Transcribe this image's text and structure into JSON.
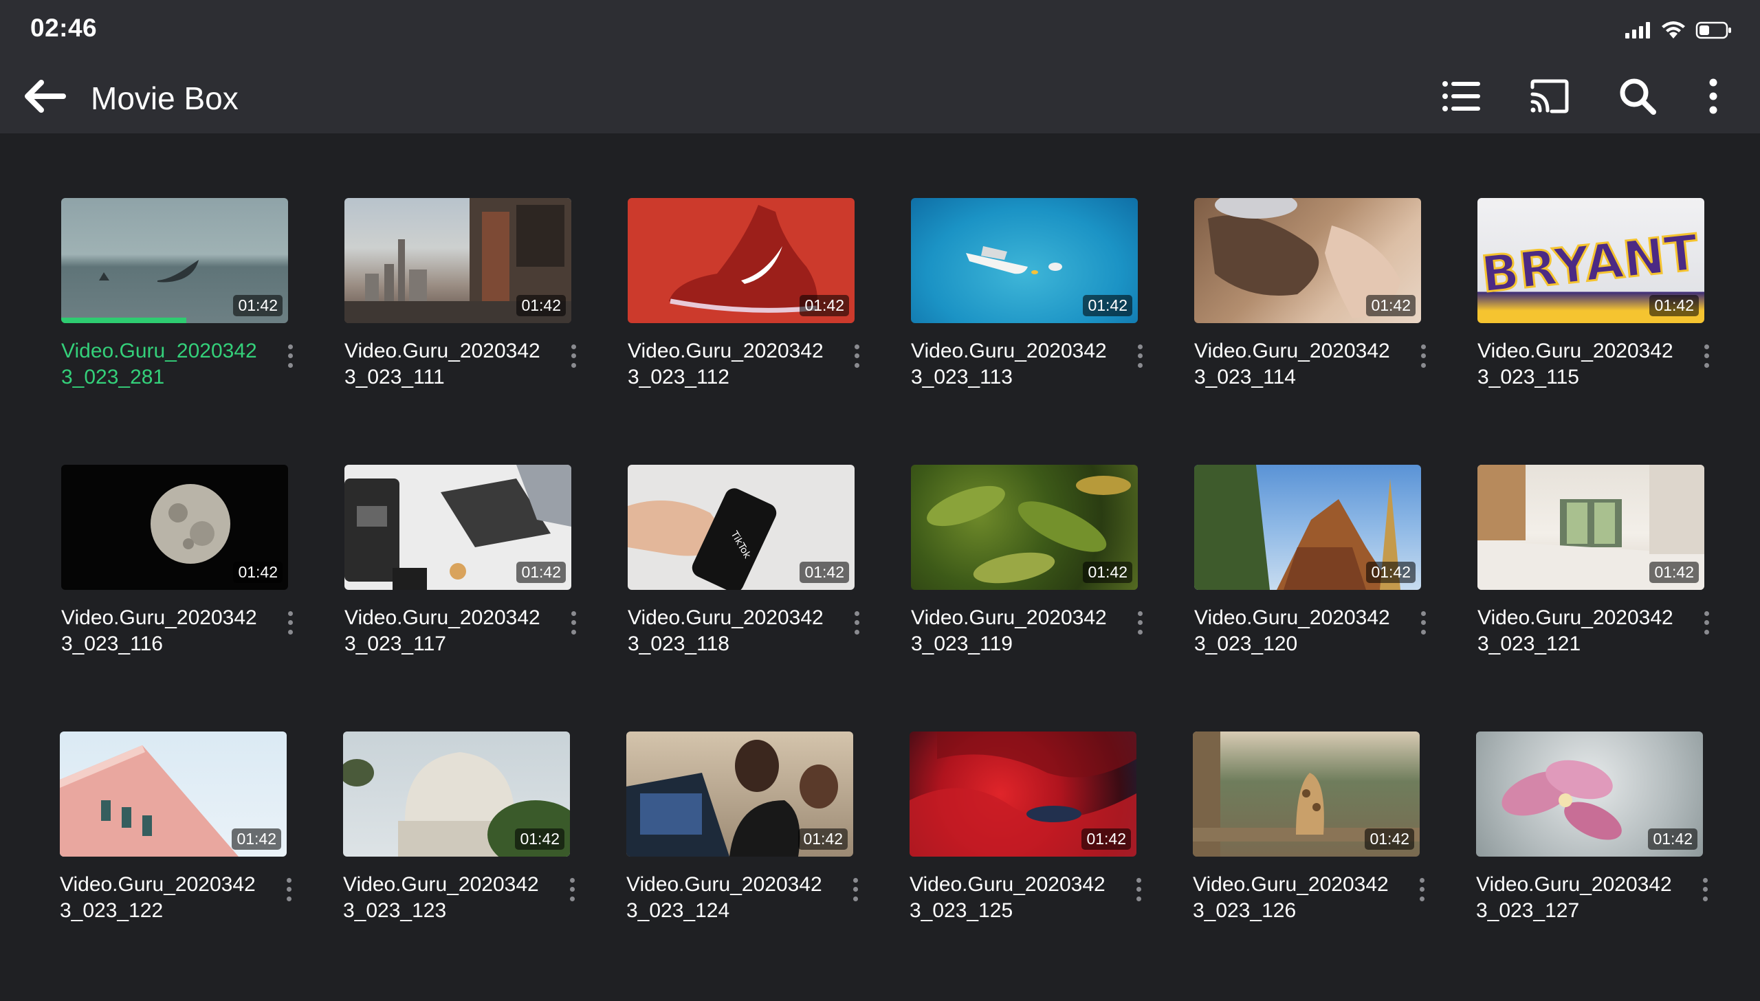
{
  "status": {
    "time": "02:46"
  },
  "appbar": {
    "title": "Movie Box",
    "icons": [
      "back-arrow-icon",
      "list-view-icon",
      "cast-icon",
      "search-icon",
      "more-vert-icon"
    ]
  },
  "accent_color": "#34d07a",
  "videos": [
    {
      "title": "Video.Guru_20203423_023_281",
      "duration": "01:42",
      "active": true,
      "progress": 0.55
    },
    {
      "title": "Video.Guru_20203423_023_111",
      "duration": "01:42"
    },
    {
      "title": "Video.Guru_20203423_023_112",
      "duration": "01:42"
    },
    {
      "title": "Video.Guru_20203423_023_113",
      "duration": "01:42"
    },
    {
      "title": "Video.Guru_20203423_023_114",
      "duration": "01:42"
    },
    {
      "title": "Video.Guru_20203423_023_115",
      "duration": "01:42"
    },
    {
      "title": "Video.Guru_20203423_023_116",
      "duration": "01:42"
    },
    {
      "title": "Video.Guru_20203423_023_117",
      "duration": "01:42"
    },
    {
      "title": "Video.Guru_20203423_023_118",
      "duration": "01:42"
    },
    {
      "title": "Video.Guru_20203423_023_119",
      "duration": "01:42"
    },
    {
      "title": "Video.Guru_20203423_023_120",
      "duration": "01:42"
    },
    {
      "title": "Video.Guru_20203423_023_121",
      "duration": "01:42"
    },
    {
      "title": "Video.Guru_20203423_023_122",
      "duration": "01:42"
    },
    {
      "title": "Video.Guru_20203423_023_123",
      "duration": "01:42"
    },
    {
      "title": "Video.Guru_20203423_023_124",
      "duration": "01:42"
    },
    {
      "title": "Video.Guru_20203423_023_125",
      "duration": "01:42"
    },
    {
      "title": "Video.Guru_20203423_023_126",
      "duration": "01:42"
    },
    {
      "title": "Video.Guru_20203423_023_127",
      "duration": "01:42"
    }
  ]
}
